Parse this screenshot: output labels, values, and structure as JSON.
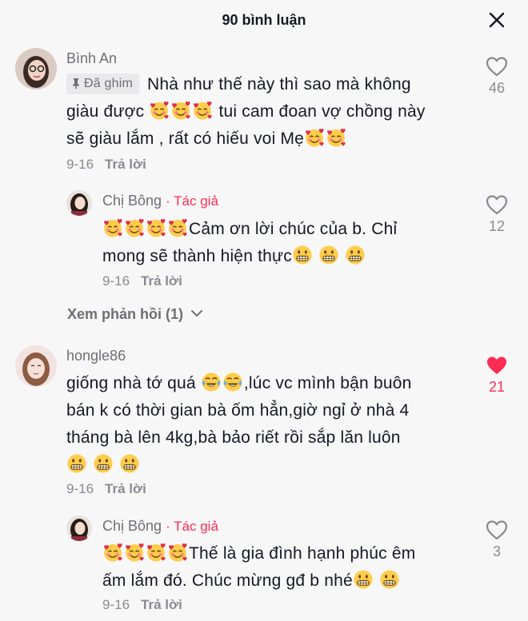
{
  "header": {
    "title": "90 bình luận",
    "close_icon": "close-icon"
  },
  "emojis": {
    "heart_face": "smiling-face-with-hearts-emoji",
    "grin": "grinning-face-emoji",
    "tears": "tears-of-joy-emoji"
  },
  "colors": {
    "accent": "#fe2c55",
    "muted": "#8a8b91"
  },
  "comments": [
    {
      "username": "Bình An",
      "pinned_label": "Đã ghim",
      "line1": "Nhà như thế này thì sao mà không",
      "line2a": "giàu được",
      "line2b": " tui cam đoan vợ chồng này",
      "line3": "sẽ giàu lắm , rất có hiếu voi Mẹ",
      "date": "9-16",
      "reply_label": "Trả lời",
      "likes": "46",
      "replies": [
        {
          "username": "Chị Bông",
          "author_tag": "Tác giả",
          "line1": "Cảm ơn lời chúc của b. Chỉ",
          "line2": "mong sẽ thành hiện thực",
          "date": "9-16",
          "reply_label": "Trả lời",
          "likes": "12"
        }
      ],
      "view_replies": "Xem phản hồi (1)"
    },
    {
      "username": "hongle86",
      "line1a": "giống nhà tớ quá ",
      "line1b": ",lúc vc mình bận buôn",
      "line2": "bán k có thời gian bà ốm hẳn,giờ ngỉ ở nhà 4",
      "line3": "tháng bà lên 4kg,bà bảo riết rồi sắp lăn luôn",
      "date": "9-16",
      "reply_label": "Trả lời",
      "likes": "21",
      "liked": true,
      "replies": [
        {
          "username": "Chị Bông",
          "author_tag": "Tác giả",
          "line1": "Thế là gia đình hạnh phúc êm",
          "line2": "ấm lắm đó. Chúc mừng gđ b nhé",
          "date": "9-16",
          "reply_label": "Trả lời",
          "likes": "3"
        }
      ]
    }
  ]
}
